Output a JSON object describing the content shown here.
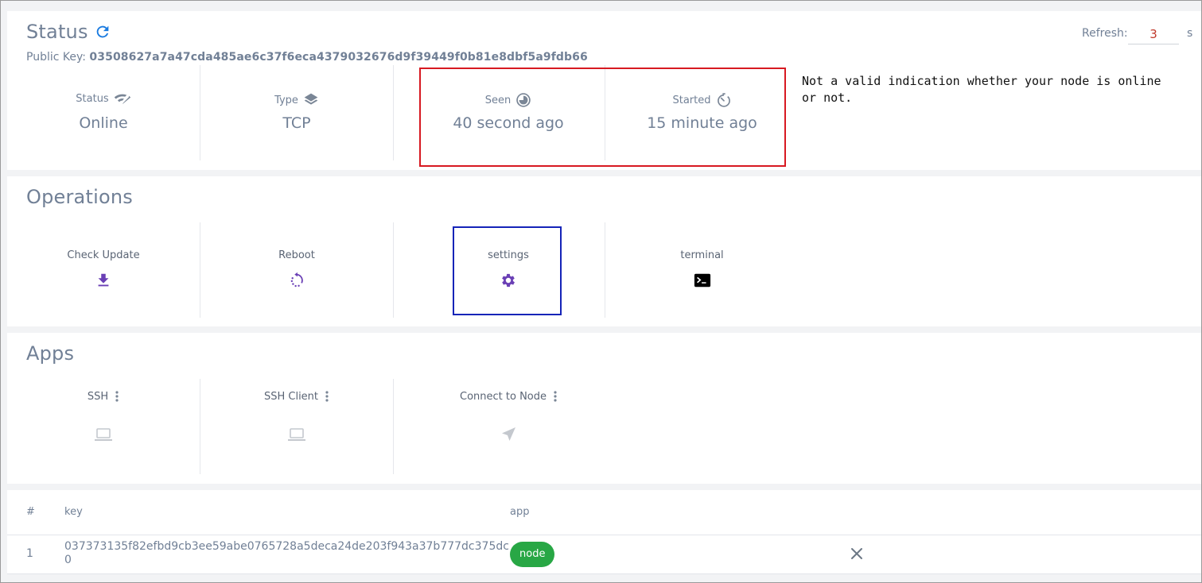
{
  "status": {
    "title": "Status",
    "public_key_label": "Public Key:",
    "public_key": "03508627a7a47cda485ae6c37f6eca4379032676d9f39449f0b81e8dbf5a9fdb66",
    "refresh_label": "Refresh:",
    "refresh_value": "3",
    "refresh_unit": "s",
    "stats": [
      {
        "label": "Status",
        "value": "Online",
        "icon": "wifi-icon"
      },
      {
        "label": "Type",
        "value": "TCP",
        "icon": "layers-icon"
      },
      {
        "label": "Seen",
        "value": "40 second ago",
        "icon": "pie-clock-icon"
      },
      {
        "label": "Started",
        "value": "15 minute ago",
        "icon": "timer-icon"
      }
    ]
  },
  "annotation": {
    "note": "Not a valid indication whether your node is online or not.",
    "highlight_color": "#d71921",
    "selection_color": "#1524b8"
  },
  "operations": {
    "title": "Operations",
    "items": [
      {
        "label": "Check Update",
        "icon": "download-icon"
      },
      {
        "label": "Reboot",
        "icon": "reboot-icon"
      },
      {
        "label": "settings",
        "icon": "gear-icon"
      },
      {
        "label": "terminal",
        "icon": "terminal-icon"
      }
    ]
  },
  "apps": {
    "title": "Apps",
    "items": [
      {
        "label": "SSH",
        "icon": "laptop-icon"
      },
      {
        "label": "SSH Client",
        "icon": "laptop-icon"
      },
      {
        "label": "Connect to Node",
        "icon": "send-icon"
      }
    ]
  },
  "table": {
    "headers": [
      "#",
      "key",
      "app"
    ],
    "rows": [
      {
        "index": "1",
        "key": "037373135f82efbd9cb3ee59abe0765728a5deca24de203f943a37b777dc375dc0",
        "app": "node"
      }
    ]
  },
  "colors": {
    "accent": "#6a3fb5",
    "refresh_icon": "#1a7be0",
    "badge": "#28a745"
  }
}
